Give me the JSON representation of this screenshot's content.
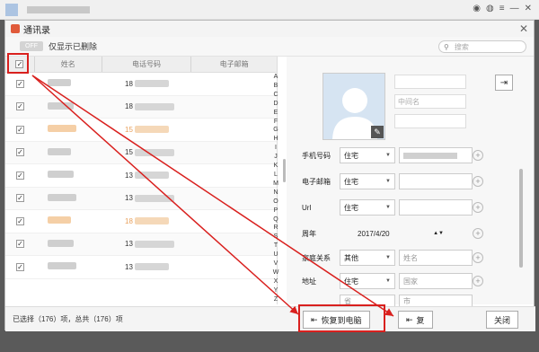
{
  "window": {
    "title": "通讯录"
  },
  "filter": {
    "toggle_label": "OFF",
    "show_deleted_label": "仅显示已删除"
  },
  "search": {
    "placeholder": "搜索"
  },
  "list": {
    "columns": [
      "姓名",
      "电话号码",
      "电子邮箱"
    ],
    "rows": [
      {
        "phone": "18",
        "name_color": "#cfcfcf",
        "phone_color": "#333333"
      },
      {
        "phone": "18",
        "name_color": "#cfcfcf",
        "phone_color": "#333333"
      },
      {
        "phone": "15",
        "name_color": "#f5cfa6",
        "phone_color": "#e8a05c"
      },
      {
        "phone": "15",
        "name_color": "#cfcfcf",
        "phone_color": "#333333"
      },
      {
        "phone": "13",
        "name_color": "#cfcfcf",
        "phone_color": "#333333"
      },
      {
        "phone": "13",
        "name_color": "#cfcfcf",
        "phone_color": "#333333"
      },
      {
        "phone": "18",
        "name_color": "#f5cfa6",
        "phone_color": "#e8a05c"
      },
      {
        "phone": "13",
        "name_color": "#cfcfcf",
        "phone_color": "#333333"
      },
      {
        "phone": "13",
        "name_color": "#cfcfcf",
        "phone_color": "#333333"
      }
    ],
    "alphabet": [
      "A",
      "B",
      "C",
      "D",
      "E",
      "F",
      "G",
      "H",
      "I",
      "J",
      "K",
      "L",
      "M",
      "N",
      "O",
      "P",
      "Q",
      "R",
      "S",
      "T",
      "U",
      "V",
      "W",
      "X",
      "Y",
      "Z"
    ]
  },
  "detail": {
    "middle_name_placeholder": "中间名",
    "fields": {
      "phone_label": "手机号码",
      "phone_type": "住宅",
      "email_label": "电子邮箱",
      "email_type": "住宅",
      "url_label": "Url",
      "url_type": "住宅",
      "anniversary_label": "周年",
      "anniversary_value": "2017/4/20",
      "family_label": "家庭关系",
      "family_type": "其他",
      "family_placeholder": "姓名",
      "address_label": "地址",
      "address_type": "住宅",
      "address_placeholder": "国家",
      "province_placeholder": "省",
      "city_placeholder": "市"
    }
  },
  "footer": {
    "status": "已选择（176）项，总共（176）项",
    "restore_label": "恢复到电脑",
    "restore_device_label": "复",
    "close_label": "关闭"
  },
  "colors": {
    "highlight": "#d9201e",
    "accent": "#e05a3a"
  }
}
